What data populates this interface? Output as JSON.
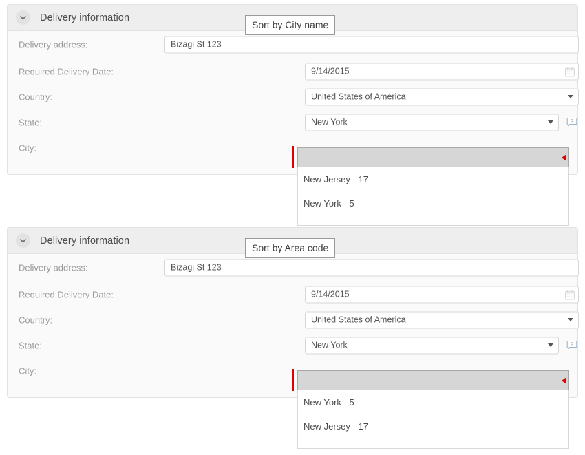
{
  "panels": [
    {
      "title": "Delivery information",
      "collapse_icon": "chevron-down-icon",
      "sort_label": "Sort by City name",
      "fields": {
        "address_label": "Delivery address:",
        "address_value": "Bizagi St 123",
        "date_label": "Required Delivery Date:",
        "date_value": "9/14/2015",
        "date_icon": "calendar-icon",
        "country_label": "Country:",
        "country_value": "United States of America",
        "state_label": "State:",
        "state_value": "New York",
        "state_help_icon": "help-balloon-icon",
        "city_label": "City:",
        "city_value": "------------"
      },
      "city_options": [
        "New Jersey - 17",
        "New York - 5"
      ]
    },
    {
      "title": "Delivery information",
      "collapse_icon": "chevron-down-icon",
      "sort_label": "Sort by Area code",
      "fields": {
        "address_label": "Delivery address:",
        "address_value": "Bizagi St 123",
        "date_label": "Required Delivery Date:",
        "date_value": "9/14/2015",
        "date_icon": "calendar-icon",
        "country_label": "Country:",
        "country_value": "United States of America",
        "state_label": "State:",
        "state_value": "New York",
        "state_help_icon": "help-balloon-icon",
        "city_label": "City:",
        "city_value": "------------"
      },
      "city_options": [
        "New York - 5",
        "New Jersey - 17"
      ]
    }
  ],
  "colors": {
    "required_marker": "#e10000",
    "panel_header": "#eeeeee",
    "panel_body": "#fafafa",
    "selected_option": "#d6d6d6"
  }
}
